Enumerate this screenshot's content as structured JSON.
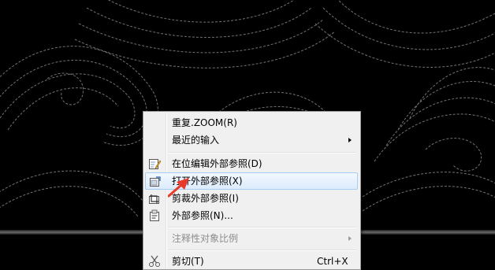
{
  "context_menu": {
    "items": [
      {
        "label": "重复.ZOOM(R)"
      },
      {
        "label": "最近的输入"
      },
      {
        "label": "在位编辑外部参照(D)"
      },
      {
        "label": "打开外部参照(X)"
      },
      {
        "label": "剪裁外部参照(I)"
      },
      {
        "label": "外部参照(N)..."
      },
      {
        "label": "注释性对象比例"
      },
      {
        "label": "剪切(T)"
      },
      {
        "shortcut": "Ctrl+X"
      }
    ]
  },
  "icons": [
    "edit-xref-icon",
    "open-xref-icon",
    "clip-xref-icon",
    "xref-manager-icon",
    "cut-icon"
  ],
  "colors": {
    "background": "#000000",
    "menu": "#f0f0f0",
    "highlight": "#dcebfc",
    "pointer": "#e83a2a"
  }
}
